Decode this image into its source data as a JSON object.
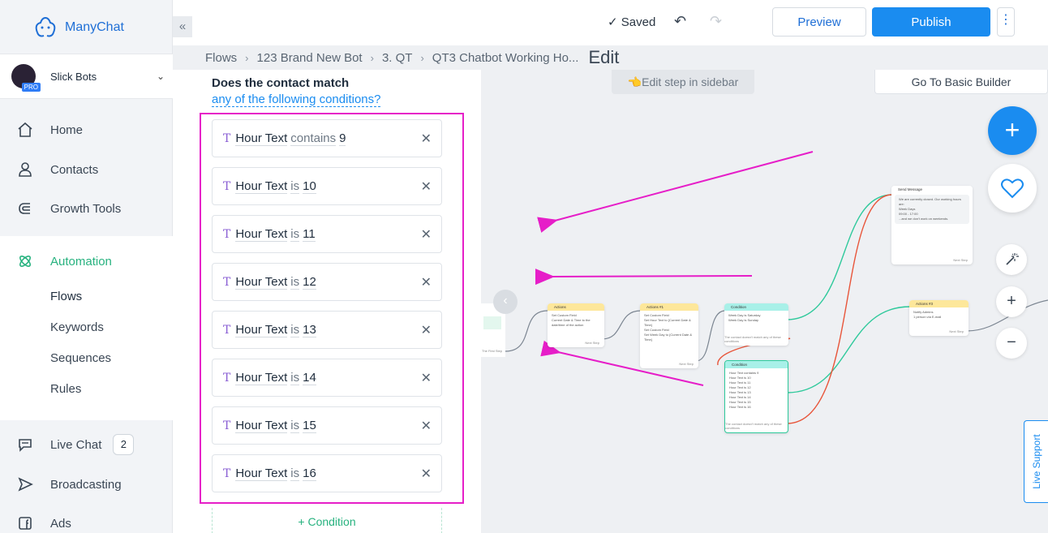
{
  "app": {
    "name": "ManyChat"
  },
  "account": {
    "name": "Slick Bots",
    "plan_badge": "PRO"
  },
  "nav": {
    "items": [
      {
        "label": "Home",
        "icon": "home-icon"
      },
      {
        "label": "Contacts",
        "icon": "user-icon"
      },
      {
        "label": "Growth Tools",
        "icon": "magnet-icon"
      },
      {
        "label": "Automation",
        "icon": "atom-icon"
      },
      {
        "label": "Live Chat",
        "icon": "chat-bubble-icon",
        "badge": "2"
      },
      {
        "label": "Broadcasting",
        "icon": "send-icon"
      },
      {
        "label": "Ads",
        "icon": "facebook-icon"
      }
    ],
    "automation_sub": [
      "Flows",
      "Keywords",
      "Sequences",
      "Rules"
    ]
  },
  "toolbar": {
    "collapse": "«",
    "saved_label": "Saved",
    "preview_label": "Preview",
    "publish_label": "Publish",
    "more_label": "⋮"
  },
  "breadcrumb": [
    "Flows",
    "123 Brand New Bot",
    "3. QT",
    "QT3 Chatbot Working Ho..."
  ],
  "breadcrumb_current": "Edit",
  "canvas": {
    "edit_hint": "👈Edit step in sidebar",
    "basic_builder": "Go To Basic Builder",
    "live_support": "Live Support"
  },
  "panel": {
    "question_line1": "Does the contact match",
    "question_line2": "any of the following conditions?",
    "conditions": [
      {
        "field": "Hour Text",
        "operator": "contains",
        "value": "9"
      },
      {
        "field": "Hour Text",
        "operator": "is",
        "value": "10"
      },
      {
        "field": "Hour Text",
        "operator": "is",
        "value": "11"
      },
      {
        "field": "Hour Text",
        "operator": "is",
        "value": "12"
      },
      {
        "field": "Hour Text",
        "operator": "is",
        "value": "13"
      },
      {
        "field": "Hour Text",
        "operator": "is",
        "value": "14"
      },
      {
        "field": "Hour Text",
        "operator": "is",
        "value": "15"
      },
      {
        "field": "Hour Text",
        "operator": "is",
        "value": "16"
      }
    ],
    "add_condition": "+ Condition"
  },
  "nodes": {
    "send_message": {
      "title": "Send Message",
      "lines": [
        "We are currently closed. Our working hours are:",
        "Week Days",
        "09:00 - 17:00",
        "...and we don't work on weekends."
      ],
      "footer": "Next Step"
    },
    "actions": {
      "title": "Actions",
      "lines": [
        "Set Custom Field",
        "Current Date & Time to the date/time of the action"
      ],
      "footer": "Next Step"
    },
    "actions1": {
      "title": "Actions #1",
      "lines": [
        "Set Custom Field",
        "Set Hour Text to {Current Date & Time}",
        "Set Custom Field",
        "Set Week Day to {Current Date & Time}"
      ],
      "footer": "Next Step"
    },
    "condition": {
      "title": "Condition",
      "lines": [
        "Week Day is Saturday",
        "Week Day is Sunday"
      ],
      "footer": "The contact doesn't match any of these conditions"
    },
    "condition2": {
      "title": "Condition",
      "lines": [
        "Hour Text contains 9",
        "Hour Text is 10",
        "Hour Text is 11",
        "Hour Text is 12",
        "Hour Text is 13",
        "Hour Text is 14",
        "Hour Text is 15",
        "Hour Text is 16"
      ],
      "footer": "The contact doesn't match any of these conditions"
    },
    "actions3": {
      "title": "Actions #3",
      "lines": [
        "Notify Admins",
        "1 person via E-mail"
      ],
      "footer": "Next Step"
    },
    "first_step_label": "The First Step"
  },
  "colors": {
    "accent": "#1a8cf0",
    "active_nav": "#27b27f",
    "highlight": "#e61ec8",
    "arrow": "#e61ec8",
    "flow_green": "#2ec99b",
    "flow_red": "#e8553a"
  }
}
